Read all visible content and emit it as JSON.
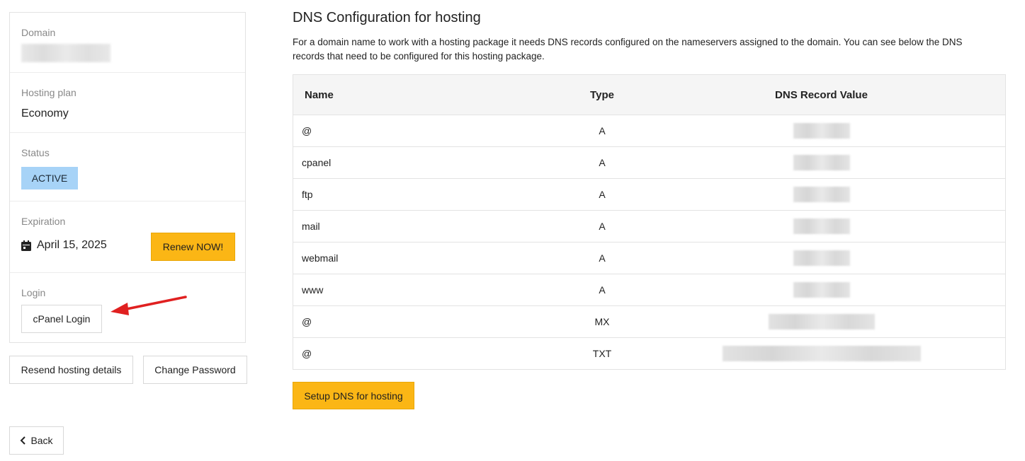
{
  "sidebar": {
    "domain": {
      "label": "Domain"
    },
    "plan": {
      "label": "Hosting plan",
      "value": "Economy"
    },
    "status": {
      "label": "Status",
      "value": "ACTIVE"
    },
    "expiration": {
      "label": "Expiration",
      "date": "April 15, 2025",
      "renew_label": "Renew NOW!"
    },
    "login": {
      "label": "Login",
      "button": "cPanel Login"
    },
    "resend_label": "Resend hosting details",
    "change_password_label": "Change Password",
    "back_label": "Back"
  },
  "main": {
    "title": "DNS Configuration for hosting",
    "description": "For a domain name to work with a hosting package it needs DNS records configured on the nameservers assigned to the domain. You can see below the DNS records that need to be configured for this hosting package.",
    "table": {
      "headers": [
        "Name",
        "Type",
        "DNS Record Value"
      ],
      "rows": [
        {
          "name": "@",
          "type": "A"
        },
        {
          "name": "cpanel",
          "type": "A"
        },
        {
          "name": "ftp",
          "type": "A"
        },
        {
          "name": "mail",
          "type": "A"
        },
        {
          "name": "webmail",
          "type": "A"
        },
        {
          "name": "www",
          "type": "A"
        },
        {
          "name": "@",
          "type": "MX"
        },
        {
          "name": "@",
          "type": "TXT"
        }
      ]
    },
    "setup_button": "Setup DNS for hosting"
  },
  "colors": {
    "accent_yellow": "#fbb615",
    "status_blue": "#a7d3f7",
    "annotation_arrow": "#e02020"
  },
  "icons": [
    "calendar-icon",
    "chevron-left-icon",
    "annotation-arrow"
  ]
}
